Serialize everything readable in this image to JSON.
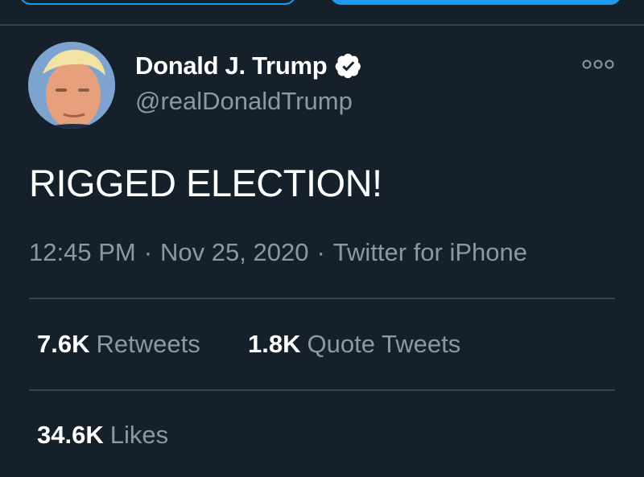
{
  "author": {
    "name": "Donald J. Trump",
    "handle": "@realDonaldTrump"
  },
  "tweet": {
    "text": "RIGGED ELECTION!",
    "time": "12:45 PM",
    "date": "Nov 25, 2020",
    "separator": "·",
    "source": "Twitter for iPhone"
  },
  "stats": {
    "retweets": {
      "count": "7.6K",
      "label": "Retweets"
    },
    "quote_tweets": {
      "count": "1.8K",
      "label": "Quote Tweets"
    },
    "likes": {
      "count": "34.6K",
      "label": "Likes"
    }
  },
  "icons": {
    "verified": "verified-badge-icon",
    "more": "more-options-icon"
  },
  "colors": {
    "background": "#15202b",
    "accent": "#1d9bf0",
    "secondary_text": "#8b98a5",
    "divider": "#38444d"
  }
}
